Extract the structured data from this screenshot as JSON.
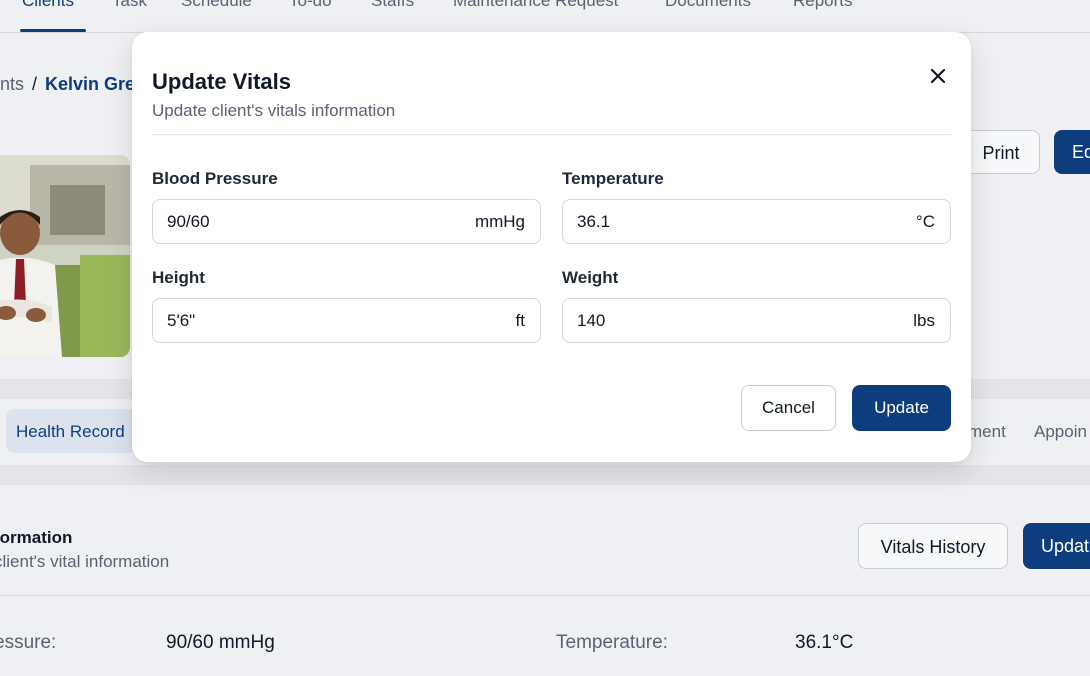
{
  "topnav": {
    "tabs": [
      "Clients",
      "Task",
      "Schedule",
      "To-do",
      "Staffs",
      "Maintenance Request",
      "Documents",
      "Reports"
    ]
  },
  "breadcrumb": {
    "parent": "nts",
    "separator": "/",
    "current": "Kelvin Gre"
  },
  "header_actions": {
    "print_label": "Print",
    "edit_label": "Ed"
  },
  "record_tabs": {
    "health_records": "Health Record",
    "t2": "ment",
    "t3": "Appoin"
  },
  "vitals_section": {
    "title": "formation",
    "subtitle": "client's vital information",
    "history_button": "Vitals History",
    "update_button": "Updat",
    "rows": [
      {
        "label": "essure:",
        "value": "90/60 mmHg",
        "label2": "Temperature:",
        "value2": "36.1°C"
      }
    ]
  },
  "modal": {
    "title": "Update Vitals",
    "subtitle": "Update client's vitals information",
    "fields": {
      "blood_pressure": {
        "label": "Blood Pressure",
        "value": "90/60",
        "unit": "mmHg"
      },
      "temperature": {
        "label": "Temperature",
        "value": "36.1",
        "unit": "°C"
      },
      "height": {
        "label": "Height",
        "value": "5'6\"",
        "unit": "ft"
      },
      "weight": {
        "label": "Weight",
        "value": "140",
        "unit": "lbs"
      }
    },
    "cancel_label": "Cancel",
    "update_label": "Update"
  },
  "colors": {
    "primary": "#0d3d7d",
    "overlay_bg": "#e6e7eb",
    "muted_text": "#5a6272"
  },
  "icons": {
    "close": "close-icon"
  }
}
